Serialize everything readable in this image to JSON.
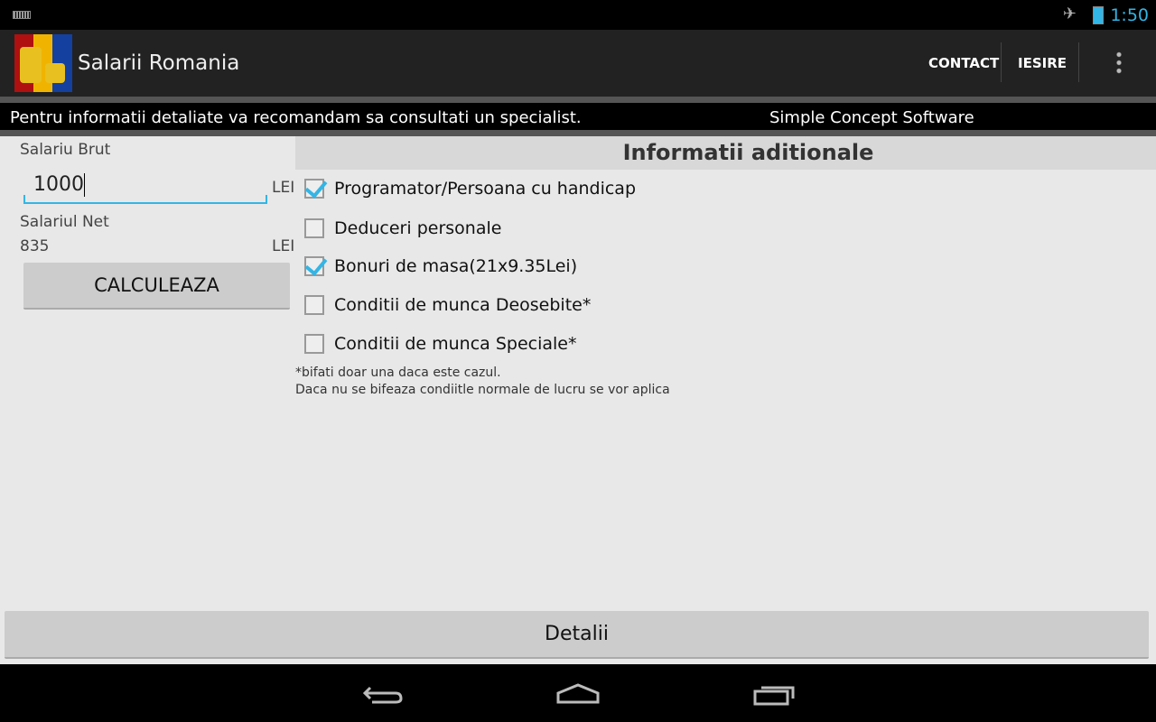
{
  "status_bar": {
    "time": "1:50",
    "icons": [
      "keyboard-icon",
      "airplane-mode-icon",
      "battery-charging-icon"
    ]
  },
  "action_bar": {
    "title": "Salarii Romania",
    "actions": [
      "CONTACT",
      "IESIRE"
    ],
    "overflow_icon": "more-vert-icon"
  },
  "notice": {
    "message": "Pentru informatii detaliate va recomandam sa consultati un specialist.",
    "company": "Simple Concept Software"
  },
  "calculator": {
    "gross_label": "Salariu Brut",
    "gross_value": "1000",
    "gross_unit": "LEI",
    "net_label": "Salariul Net",
    "net_value": "835",
    "net_unit": "LEI",
    "calculate_label": "CALCULEAZA"
  },
  "options": {
    "title": "Informatii aditionale",
    "items": [
      {
        "label": "Programator/Persoana cu handicap",
        "checked": true
      },
      {
        "label": "Deduceri personale",
        "checked": false
      },
      {
        "label": "Bonuri de masa(21x9.35Lei)",
        "checked": true
      },
      {
        "label": "Conditii de munca Deosebite*",
        "checked": false
      },
      {
        "label": "Conditii de munca Speciale*",
        "checked": false
      }
    ],
    "note1": "*bifati doar una daca este cazul.",
    "note2": "Daca nu se bifeaza condiitle normale de lucru se vor aplica"
  },
  "details_label": "Detalii",
  "accent": "#33b5e5"
}
